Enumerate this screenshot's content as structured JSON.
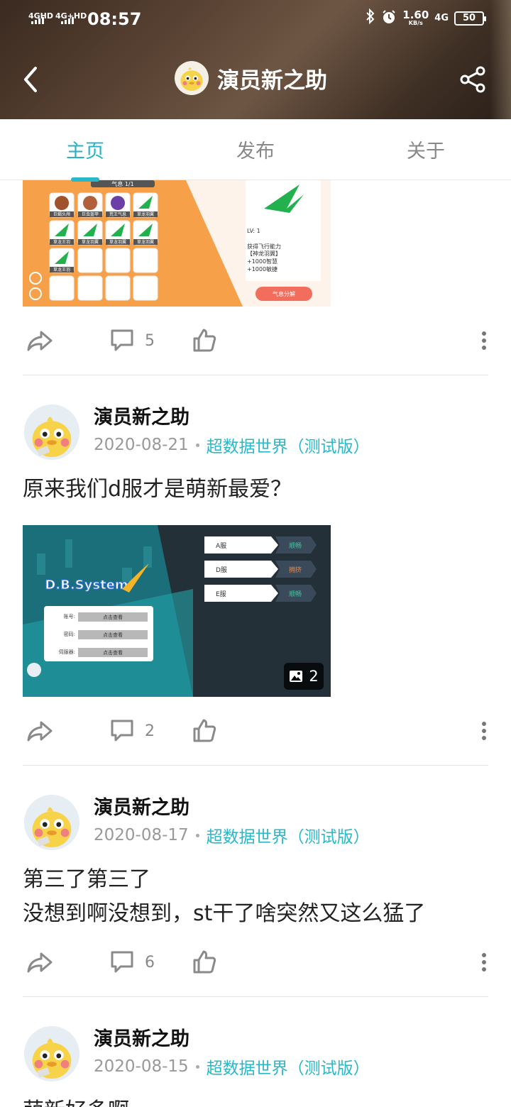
{
  "status_bar": {
    "sim1": "4GHD",
    "sim2": "4G+HD",
    "time": "08:57",
    "speed_value": "1.60",
    "speed_unit": "KB/s",
    "network_right": "4G",
    "battery": "50"
  },
  "header": {
    "title": "演员新之助"
  },
  "tabs": [
    "主页",
    "发布",
    "关于"
  ],
  "active_tab": 0,
  "posts": [
    {
      "comment_count": "5",
      "image": {
        "title": "气息 1/1",
        "grid_labels": [
          "巨蝎头颅",
          "巨虫盔甲",
          "荒王气息",
          "草龙羽翼",
          "草龙王羽",
          "草龙羽翼",
          "草龙羽翼",
          "草龙羽翼",
          "草龙王羽"
        ],
        "detail_level": "LV: 1",
        "detail_lines": [
          "获得飞行能力",
          "【神龙羽翼】",
          "+1000智慧",
          "+1000敏捷"
        ],
        "button_label": "气息分解"
      }
    },
    {
      "author": "演员新之助",
      "date": "2020-08-21",
      "topic": "超数据世界（测试版）",
      "text": "原来我们d服才是萌新最爱？",
      "comment_count": "2",
      "image": {
        "logo": "D.B.System",
        "fields": [
          "账号:",
          "密码:",
          "伺服器:"
        ],
        "field_button": "点击查看",
        "servers": [
          {
            "name": "A服",
            "status": "顺畅",
            "color": "#3ec6a0"
          },
          {
            "name": "D服",
            "status": "拥挤",
            "color": "#e88a4c"
          },
          {
            "name": "E服",
            "status": "顺畅",
            "color": "#3ec6a0"
          }
        ],
        "image_count": "2"
      }
    },
    {
      "author": "演员新之助",
      "date": "2020-08-17",
      "topic": "超数据世界（测试版）",
      "text_line1": "第三了第三了",
      "text_line2": "没想到啊没想到，st干了啥突然又这么猛了",
      "comment_count": "6"
    },
    {
      "author": "演员新之助",
      "date": "2020-08-15",
      "topic": "超数据世界（测试版）",
      "text": "萌新好多啊"
    }
  ],
  "colors": {
    "accent": "#2ab7c8",
    "icon_gray": "#8a8a8a"
  }
}
